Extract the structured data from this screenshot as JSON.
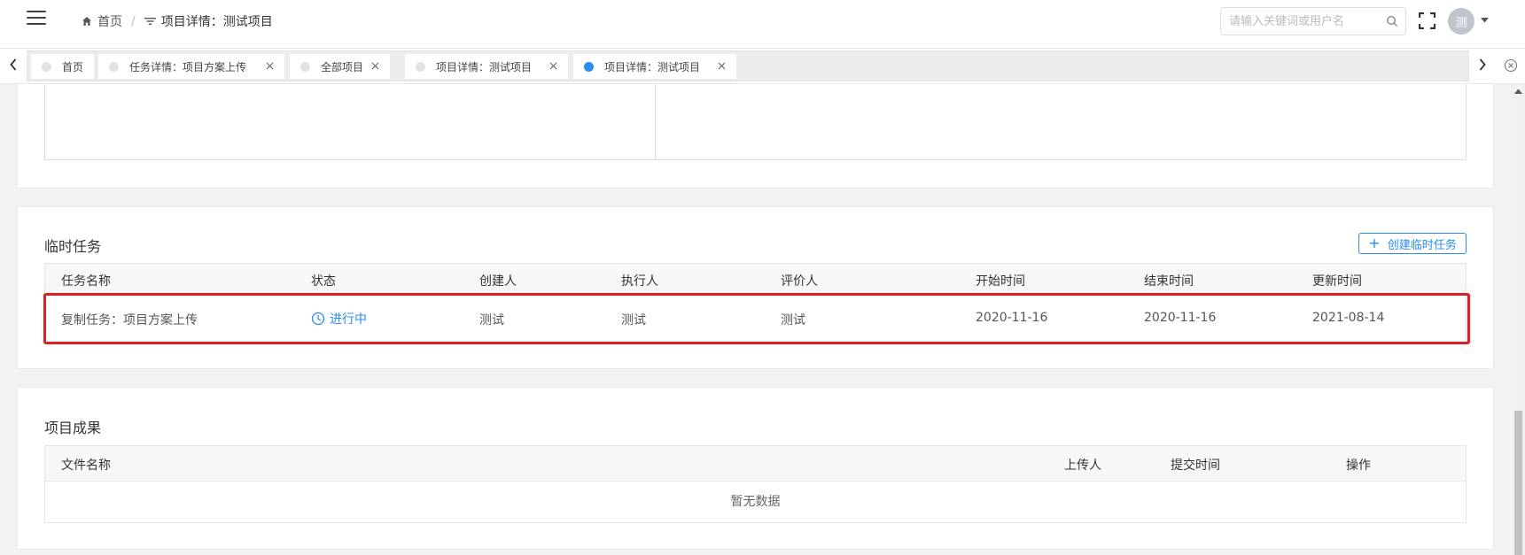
{
  "header": {
    "breadcrumb": [
      {
        "label": "首页",
        "icon": "home-icon"
      },
      {
        "label": "项目详情：测试项目",
        "icon": "filter-icon"
      }
    ],
    "breadcrumb_separator": "/",
    "search_placeholder": "请输入关键词或用户名",
    "avatar_text": "测"
  },
  "tabs": [
    {
      "label": "首页",
      "closable": false,
      "active": false
    },
    {
      "label": "任务详情：项目方案上传",
      "closable": true,
      "active": false
    },
    {
      "label": "全部项目",
      "closable": true,
      "active": false
    },
    {
      "label": "项目详情：测试项目",
      "closable": true,
      "active": false
    },
    {
      "label": "项目详情：测试项目",
      "closable": true,
      "active": true
    }
  ],
  "temp_tasks": {
    "title": "临时任务",
    "create_button": "创建临时任务",
    "columns": [
      "任务名称",
      "状态",
      "创建人",
      "执行人",
      "评价人",
      "开始时间",
      "结束时间",
      "更新时间"
    ],
    "rows": [
      {
        "name": "复制任务：项目方案上传",
        "status": "进行中",
        "creator": "测试",
        "executor": "测试",
        "reviewer": "测试",
        "start": "2020-11-16",
        "end": "2020-11-16",
        "updated": "2021-08-14"
      }
    ]
  },
  "results": {
    "title": "项目成果",
    "columns": [
      "文件名称",
      "上传人",
      "提交时间",
      "操作"
    ],
    "empty_text": "暂无数据"
  },
  "colors": {
    "accent": "#2d8cf0",
    "highlight": "#e02020"
  }
}
